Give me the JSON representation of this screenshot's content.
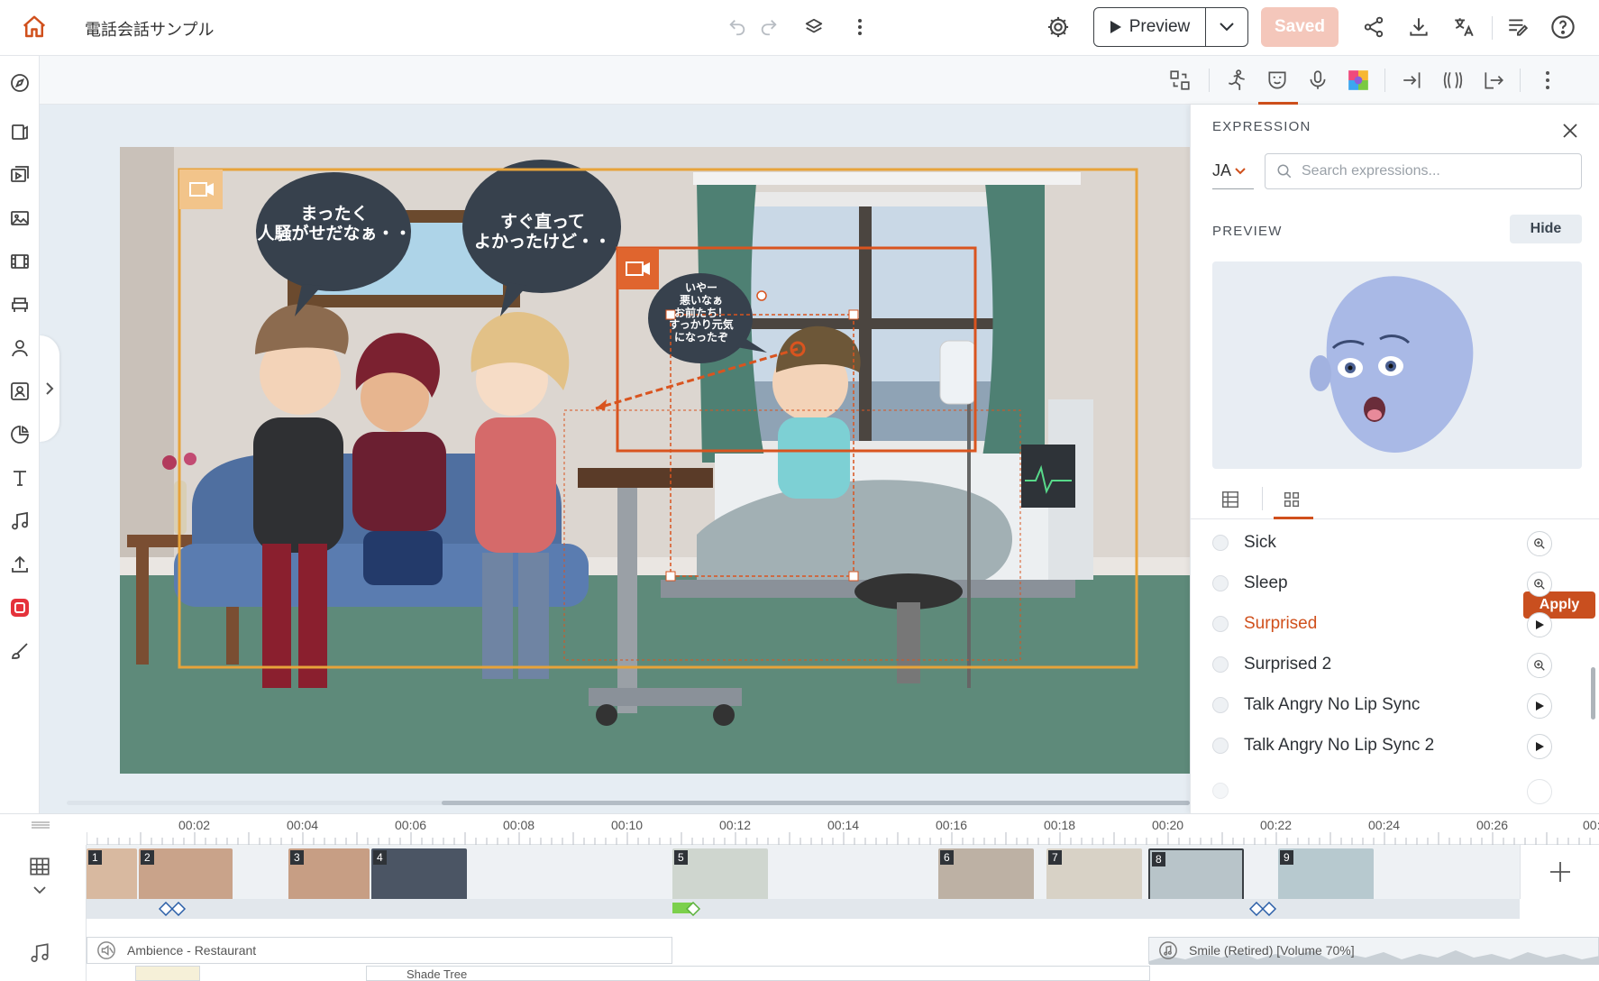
{
  "app": {
    "title": "電話会話サンプル",
    "preview_label": "Preview",
    "saved_label": "Saved"
  },
  "scene": {
    "bubbles": [
      "まったく\n人騒がせだなぁ・・",
      "すぐ直って\nよかったけど・・",
      "いやー\n悪いなぁ\nお前たち！\nすっかり元気\nになったぞ"
    ]
  },
  "panel": {
    "title": "EXPRESSION",
    "language": "JA",
    "search_placeholder": "Search expressions...",
    "preview_label": "PREVIEW",
    "hide_label": "Hide",
    "apply_label": "Apply",
    "items": [
      {
        "label": "Sick",
        "action": "zoom",
        "active": false
      },
      {
        "label": "Sleep",
        "action": "zoom",
        "active": false
      },
      {
        "label": "Surprised",
        "action": "play",
        "active": true
      },
      {
        "label": "Surprised 2",
        "action": "zoom",
        "active": false
      },
      {
        "label": "Talk Angry No Lip Sync",
        "action": "play",
        "active": false
      },
      {
        "label": "Talk Angry No Lip Sync 2",
        "action": "play",
        "active": false
      }
    ]
  },
  "timeline": {
    "ticks": [
      "00:02",
      "00:04",
      "00:06",
      "00:08",
      "00:10",
      "00:12",
      "00:14",
      "00:16",
      "00:18",
      "00:20",
      "00:22",
      "00:24",
      "00:26",
      "00:"
    ],
    "scenes": [
      "1",
      "2",
      "3",
      "4",
      "5",
      "6",
      "7",
      "8",
      "9"
    ],
    "audio": [
      "Ambience - Restaurant",
      "Smile (Retired) [Volume 70%]",
      "Shade Tree"
    ]
  },
  "colors": {
    "accent": "#d0501c",
    "saved_bg": "#f4c7bb",
    "apply_bg": "#c94f1f",
    "selection_orange": "#e7a33a"
  }
}
